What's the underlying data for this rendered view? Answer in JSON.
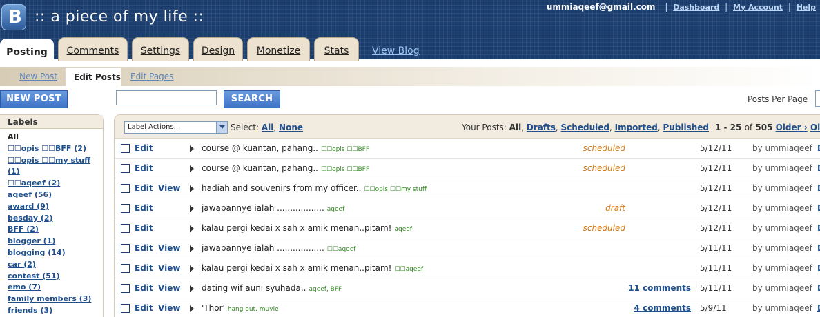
{
  "header": {
    "blog_title": ":: a piece of my life ::",
    "logo_letter": "B",
    "email": "ummiaqeef@gmail.com",
    "links": [
      "Dashboard",
      "My Account",
      "Help"
    ]
  },
  "tabs": [
    "Posting",
    "Comments",
    "Settings",
    "Design",
    "Monetize",
    "Stats"
  ],
  "active_tab": "Posting",
  "view_blog": "View Blog",
  "subtabs": {
    "new_post": "New Post",
    "edit_posts": "Edit Posts",
    "edit_pages": "Edit Pages"
  },
  "toolbar": {
    "new_post": "NEW POST",
    "search_value": "",
    "search": "SEARCH",
    "posts_per_page": "Posts Per Page"
  },
  "labels": {
    "heading": "Labels",
    "items": [
      "All",
      "☐☐opis ☐☐BFF (2)",
      "☐☐opis ☐☐my stuff (1)",
      "☐☐aqeef (2)",
      "aqeef (56)",
      "award (9)",
      "besday (2)",
      "BFF (2)",
      "blogger (1)",
      "blogging (14)",
      "car (2)",
      "contest (51)",
      "emo (7)",
      "family members (3)",
      "friends (3)"
    ]
  },
  "posts_header": {
    "label_actions": "Label Actions...",
    "select_prefix": "Select:",
    "select_all": "All",
    "select_none": "None",
    "your_posts_prefix": "Your Posts:",
    "current_filter": "All",
    "filters": [
      "Drafts",
      "Scheduled",
      "Imported",
      "Published"
    ],
    "range": "1 - 25",
    "of": "of",
    "total": "505",
    "older": "Older ›",
    "oldest": "Oldest"
  },
  "posts": [
    {
      "edit": "Edit",
      "view": "",
      "title": "course @ kuantan, pahang..",
      "tags": "☐☐opis ☐☐BFF",
      "status": "scheduled",
      "comments": "",
      "date": "5/12/11",
      "author": "by ummiaqeef",
      "d": "D"
    },
    {
      "edit": "Edit",
      "view": "",
      "title": "course @ kuantan, pahang..",
      "tags": "☐☐opis ☐☐BFF",
      "status": "scheduled",
      "comments": "",
      "date": "5/12/11",
      "author": "by ummiaqeef",
      "d": "D"
    },
    {
      "edit": "Edit",
      "view": "View",
      "title": "hadiah and souvenirs from my officer..",
      "tags": "☐☐opis ☐☐my stuff",
      "status": "",
      "comments": "",
      "date": "5/12/11",
      "author": "by ummiaqeef",
      "d": "D"
    },
    {
      "edit": "Edit",
      "view": "",
      "title": "jawapannye ialah ..................",
      "tags": "aqeef",
      "status": "draft",
      "comments": "",
      "date": "5/12/11",
      "author": "by ummiaqeef",
      "d": "D"
    },
    {
      "edit": "Edit",
      "view": "",
      "title": "kalau pergi kedai x sah x amik menan..pitam!",
      "tags": "aqeef",
      "status": "scheduled",
      "comments": "",
      "date": "5/12/11",
      "author": "by ummiaqeef",
      "d": "D"
    },
    {
      "edit": "Edit",
      "view": "View",
      "title": "jawapannye ialah ..................",
      "tags": "☐☐aqeef",
      "status": "",
      "comments": "",
      "date": "5/11/11",
      "author": "by ummiaqeef",
      "d": "D"
    },
    {
      "edit": "Edit",
      "view": "View",
      "title": "kalau pergi kedai x sah x amik menan..pitam!",
      "tags": "☐☐aqeef",
      "status": "",
      "comments": "",
      "date": "5/11/11",
      "author": "by ummiaqeef",
      "d": "D"
    },
    {
      "edit": "Edit",
      "view": "View",
      "title": "dating wif auni syuhada..",
      "tags": "aqeef, BFF",
      "status": "",
      "comments": "11 comments",
      "date": "5/11/11",
      "author": "by ummiaqeef",
      "d": "D"
    },
    {
      "edit": "Edit",
      "view": "View",
      "title": "'Thor'",
      "tags": "hang out, muvie",
      "status": "",
      "comments": "4 comments",
      "date": "5/9/11",
      "author": "by ummiaqeef",
      "d": "D"
    }
  ]
}
